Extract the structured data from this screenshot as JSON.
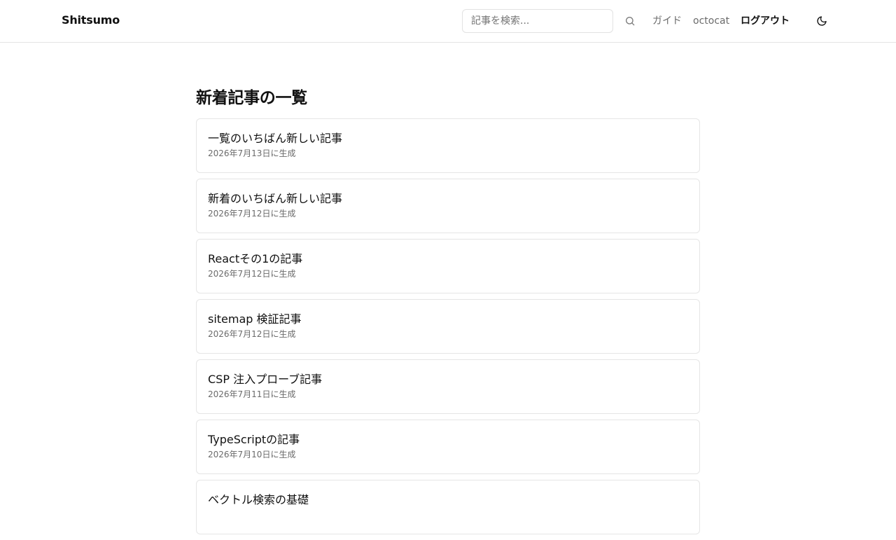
{
  "header": {
    "brand": "Shitsumo",
    "search": {
      "placeholder": "記事を検索...",
      "value": ""
    },
    "nav": {
      "guide": "ガイド",
      "user": "octocat",
      "logout": "ログアウト"
    },
    "icons": {
      "search": "search-icon",
      "theme": "moon-icon"
    }
  },
  "main": {
    "title": "新着記事の一覧",
    "articles": [
      {
        "title": "一覧のいちばん新しい記事",
        "date": "2026年7月13日に生成"
      },
      {
        "title": "新着のいちばん新しい記事",
        "date": "2026年7月12日に生成"
      },
      {
        "title": "Reactその1の記事",
        "date": "2026年7月12日に生成"
      },
      {
        "title": "sitemap 検証記事",
        "date": "2026年7月12日に生成"
      },
      {
        "title": "CSP 注入プローブ記事",
        "date": "2026年7月11日に生成"
      },
      {
        "title": "TypeScriptの記事",
        "date": "2026年7月10日に生成"
      },
      {
        "title": "ベクトル検索の基礎",
        "date": ""
      }
    ]
  },
  "colors": {
    "text": "#111111",
    "muted": "#6b6b6b",
    "border": "#e5e5e5",
    "background": "#ffffff"
  }
}
